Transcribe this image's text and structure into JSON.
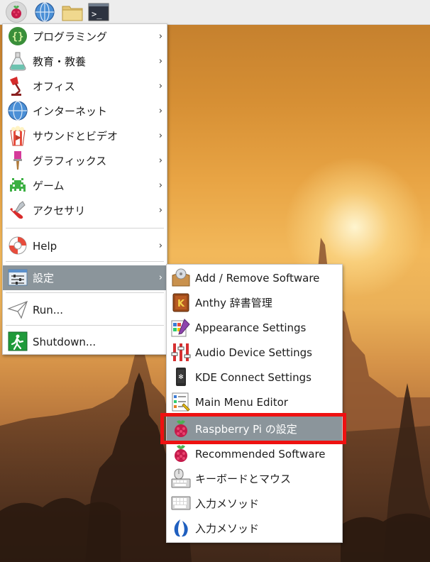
{
  "main_menu": {
    "items": [
      {
        "label": "プログラミング",
        "icon": "code-braces-icon"
      },
      {
        "label": "教育・教養",
        "icon": "flask-icon"
      },
      {
        "label": "オフィス",
        "icon": "desk-lamp-icon"
      },
      {
        "label": "インターネット",
        "icon": "globe-icon"
      },
      {
        "label": "サウンドとビデオ",
        "icon": "popcorn-icon"
      },
      {
        "label": "グラフィックス",
        "icon": "paintbrush-icon"
      },
      {
        "label": "ゲーム",
        "icon": "space-invader-icon"
      },
      {
        "label": "アクセサリ",
        "icon": "swiss-knife-icon"
      },
      {
        "label": "Help",
        "icon": "lifebuoy-icon"
      },
      {
        "label": "設定",
        "icon": "settings-panel-icon"
      },
      {
        "label": "Run...",
        "icon": "paper-plane-icon"
      },
      {
        "label": "Shutdown...",
        "icon": "exit-icon"
      }
    ],
    "arrow": "›"
  },
  "settings_submenu": {
    "items": [
      {
        "label": "Add / Remove Software",
        "icon": "package-icon"
      },
      {
        "label": "Anthy 辞書管理",
        "icon": "dictionary-icon"
      },
      {
        "label": "Appearance Settings",
        "icon": "appearance-icon"
      },
      {
        "label": "Audio Device Settings",
        "icon": "mixer-sliders-icon"
      },
      {
        "label": "KDE Connect Settings",
        "icon": "phone-icon"
      },
      {
        "label": "Main Menu Editor",
        "icon": "menu-editor-icon"
      },
      {
        "label": "Raspberry Pi の設定",
        "icon": "raspberry-icon"
      },
      {
        "label": "Recommended Software",
        "icon": "raspberry-icon"
      },
      {
        "label": "キーボードとマウス",
        "icon": "keyboard-mouse-icon"
      },
      {
        "label": "入力メソッド",
        "icon": "keyboard-icon"
      },
      {
        "label": "入力メソッド",
        "icon": "input-method-icon"
      }
    ]
  },
  "colors": {
    "selection": "#8b959b",
    "highlight_box": "#ee1111"
  }
}
